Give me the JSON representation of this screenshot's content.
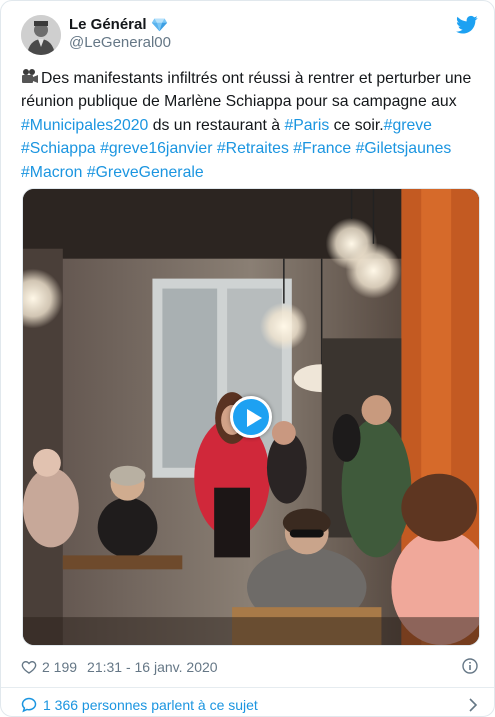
{
  "author": {
    "display_name": "Le Général",
    "handle": "@LeGeneral00",
    "verified_badge_icon": "diamond-icon",
    "avatar_icon": "avatar-portrait"
  },
  "brand": {
    "icon": "twitter-bird-icon",
    "color": "#1da1f2"
  },
  "tweet": {
    "lead_emoji": "movie-camera-icon",
    "segments": [
      {
        "text": "Des manifestants infiltrés ont réussi à rentrer et perturber une réunion publique de Marlène Schiappa  pour sa campagne aux ",
        "tag": false
      },
      {
        "text": "#Municipales2020",
        "tag": true
      },
      {
        "text": " ds un restaurant à ",
        "tag": false
      },
      {
        "text": "#Paris",
        "tag": true
      },
      {
        "text": " ce soir.",
        "tag": false
      },
      {
        "text": "#greve",
        "tag": true
      },
      {
        "text": " ",
        "tag": false
      },
      {
        "text": "#Schiappa",
        "tag": true
      },
      {
        "text": " ",
        "tag": false
      },
      {
        "text": "#greve16janvier",
        "tag": true
      },
      {
        "text": " ",
        "tag": false
      },
      {
        "text": "#Retraites",
        "tag": true
      },
      {
        "text": " ",
        "tag": false
      },
      {
        "text": "#France",
        "tag": true
      },
      {
        "text": " ",
        "tag": false
      },
      {
        "text": "#Giletsjaunes",
        "tag": true
      },
      {
        "text": " ",
        "tag": false
      },
      {
        "text": "#Macron",
        "tag": true
      },
      {
        "text": " ",
        "tag": false
      },
      {
        "text": "#GreveGenerale",
        "tag": true
      }
    ],
    "hashtag_color": "#1b95e0"
  },
  "media": {
    "type": "video",
    "play_icon": "play-icon"
  },
  "footer": {
    "like_icon": "heart-icon",
    "like_count": "2 199",
    "timestamp": "21:31 - 16 janv. 2020",
    "info_icon": "info-icon"
  },
  "conversation": {
    "icon": "chat-bubble-icon",
    "label": "1 366 personnes parlent à ce sujet",
    "chevron_icon": "chevron-right-icon"
  }
}
